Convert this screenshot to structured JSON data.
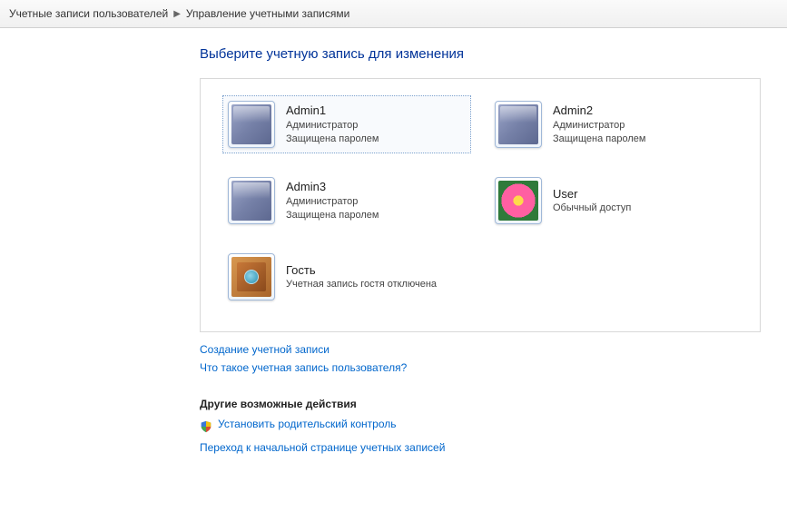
{
  "breadcrumb": {
    "root": "Учетные записи пользователей",
    "current": "Управление учетными записями"
  },
  "page_title": "Выберите учетную запись для изменения",
  "accounts": [
    {
      "name": "Admin1",
      "role": "Администратор",
      "status": "Защищена паролем",
      "avatar": "default",
      "selected": true
    },
    {
      "name": "Admin2",
      "role": "Администратор",
      "status": "Защищена паролем",
      "avatar": "default",
      "selected": false
    },
    {
      "name": "Admin3",
      "role": "Администратор",
      "status": "Защищена паролем",
      "avatar": "default",
      "selected": false
    },
    {
      "name": "User",
      "role": "Обычный доступ",
      "status": "",
      "avatar": "flower",
      "selected": false
    },
    {
      "name": "Гость",
      "role": "Учетная запись гостя отключена",
      "status": "",
      "avatar": "guest",
      "selected": false,
      "full": true
    }
  ],
  "links": {
    "create_account": "Создание учетной записи",
    "what_is_account": "Что такое учетная запись пользователя?"
  },
  "other_actions": {
    "title": "Другие возможные действия",
    "parental_control": "Установить родительский контроль",
    "goto_home": "Переход к начальной странице учетных записей"
  }
}
